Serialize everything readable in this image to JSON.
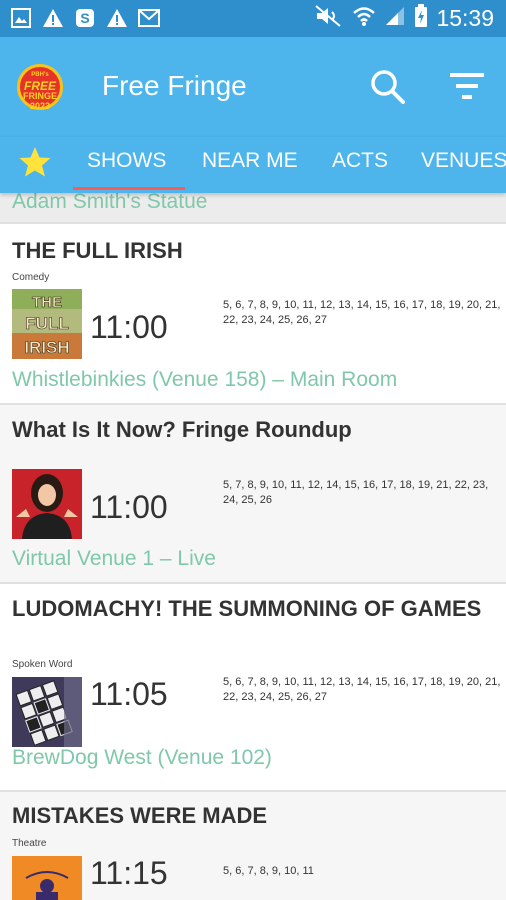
{
  "status_bar": {
    "time": "15:39",
    "icons_left": [
      "image-icon",
      "warning-icon",
      "skype-icon",
      "warning-icon",
      "gmail-icon"
    ],
    "icons_right": [
      "mute-icon",
      "wifi-icon",
      "signal-icon",
      "battery-charging-icon"
    ]
  },
  "app_bar": {
    "title": "Free Fringe",
    "logo_text": {
      "top": "PBH's",
      "main": "FREE",
      "sub": "FRINGE 2023"
    }
  },
  "tabs": {
    "selected": "SHOWS",
    "items": [
      "SHOWS",
      "NEAR ME",
      "ACTS",
      "VENUES"
    ]
  },
  "list": {
    "previous_venue": "Adam Smith's Statue",
    "cards": [
      {
        "title": "THE FULL IRISH",
        "category": "Comedy",
        "thumbnail_text": [
          "THE",
          "FULL",
          "IRISH"
        ],
        "time": "11:00",
        "dates": "5, 6, 7, 8, 9, 10, 11, 12, 13, 14, 15, 16, 17, 18, 19, 20, 21, 22, 23, 24, 25, 26, 27",
        "venue": "Whistlebinkies (Venue 158) – Main Room"
      },
      {
        "title": "What Is It Now? Fringe Roundup",
        "category": "",
        "time": "11:00",
        "dates": "5, 7, 8, 9, 10, 11, 12, 14, 15, 16, 17, 18, 19, 21, 22, 23, 24, 25, 26",
        "venue": "Virtual Venue 1 – Live"
      },
      {
        "title": "LUDOMACHY! THE SUMMONING OF GAMES",
        "category": "Spoken Word",
        "time": "11:05",
        "dates": "5, 6, 7, 8, 9, 10, 11, 12, 13, 14, 15, 16, 17, 18, 19, 20, 21, 22, 23, 24, 25, 26, 27",
        "venue": "BrewDog West (Venue 102)"
      },
      {
        "title": "MISTAKES WERE MADE",
        "category": "Theatre",
        "time": "11:15",
        "dates": "5, 6, 7, 8, 9, 10, 11",
        "venue": ""
      }
    ]
  },
  "colors": {
    "status_bar": "#2f8fcc",
    "app_bar": "#4db4ec",
    "tab_indicator": "#ff5a4f",
    "venue_text": "#7fc8a9",
    "star": "#ffe23b"
  }
}
